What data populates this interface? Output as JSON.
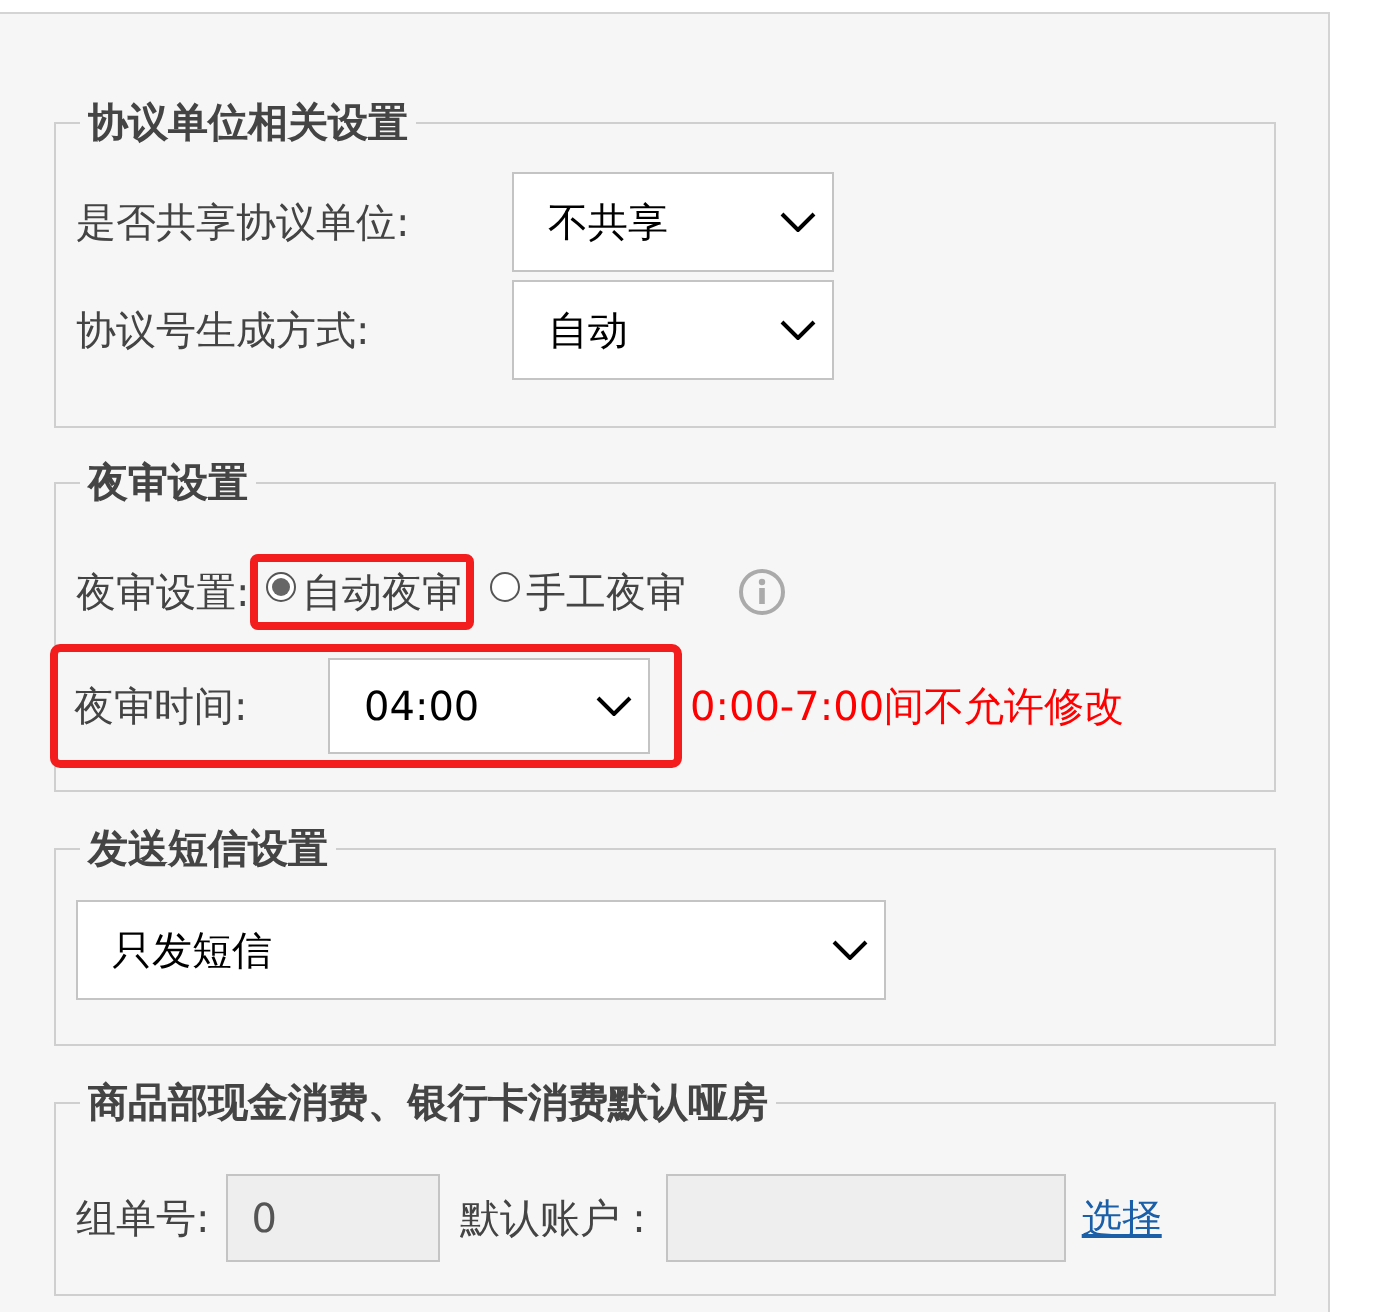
{
  "agreement": {
    "legend": "协议单位相关设置",
    "rows": [
      {
        "label": "是否共享协议单位:",
        "value": "不共享"
      },
      {
        "label": "协议号生成方式:",
        "value": "自动"
      }
    ]
  },
  "night_audit": {
    "legend": "夜审设置",
    "mode_label": "夜审设置:",
    "options": [
      {
        "label": "自动夜审",
        "selected": true,
        "highlighted": true
      },
      {
        "label": "手工夜审",
        "selected": false,
        "highlighted": false
      }
    ],
    "time_label": "夜审时间:",
    "time_value": "04:00",
    "time_highlighted": true,
    "note": "0:00-7:00间不允许修改"
  },
  "sms": {
    "legend": "发送短信设置",
    "value": "只发短信"
  },
  "default_room": {
    "legend": "商品部现金消费、银行卡消费默认哑房",
    "group_label": "组单号:",
    "group_value": "0",
    "account_label": "默认账户 :",
    "link": "选择"
  }
}
